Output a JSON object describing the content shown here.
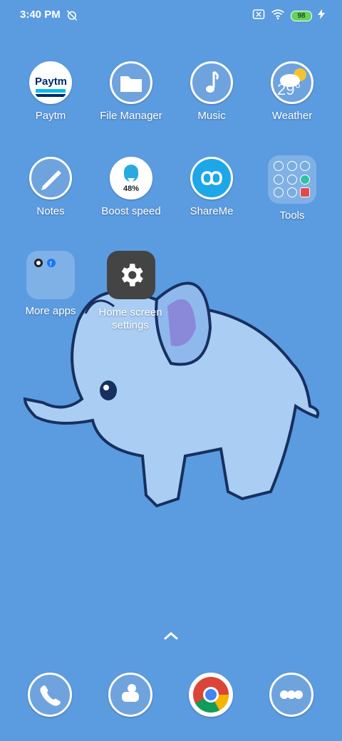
{
  "status_bar": {
    "time": "3:40 PM",
    "battery": "98"
  },
  "apps_row1": [
    {
      "label": "Paytm"
    },
    {
      "label": "File Manager"
    },
    {
      "label": "Music"
    },
    {
      "label": "Weather",
      "temp": "29°"
    }
  ],
  "apps_row2": [
    {
      "label": "Notes"
    },
    {
      "label": "Boost speed",
      "value": "48%"
    },
    {
      "label": "ShareMe"
    },
    {
      "label": "Tools"
    }
  ],
  "folder_more": {
    "label": "More apps"
  },
  "home_settings": {
    "label": "Home screen settings"
  },
  "paytm_logo_text": "Paytm",
  "colors": {
    "background": "#5b9be0",
    "settings_tile": "#444444",
    "battery": "#65d35a"
  }
}
